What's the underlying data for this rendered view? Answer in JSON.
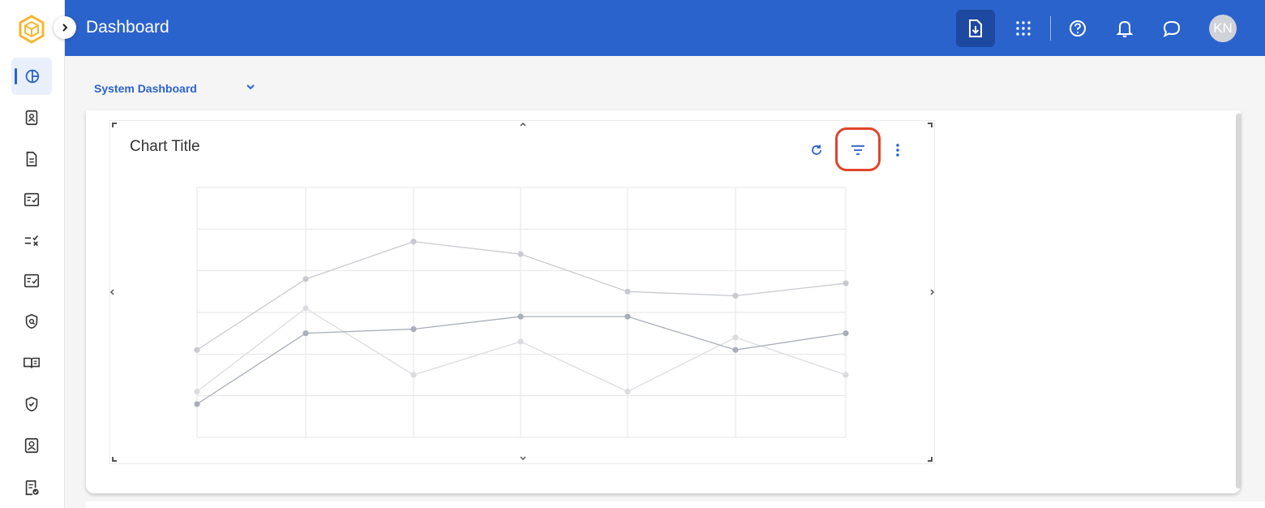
{
  "header": {
    "title": "Dashboard",
    "avatar_initials": "KN"
  },
  "dashboard_selector": {
    "value": "System Dashboard"
  },
  "widget": {
    "title": "Chart Title"
  },
  "colors": {
    "brand": "#2b63cc",
    "highlight": "#e0452a"
  },
  "sidebar": {
    "items": [
      {
        "icon": "dashboard-pie-icon",
        "active": true
      },
      {
        "icon": "contact-card-icon"
      },
      {
        "icon": "document-icon"
      },
      {
        "icon": "checklist-icon"
      },
      {
        "icon": "list-check-x-icon"
      },
      {
        "icon": "task-list-icon"
      },
      {
        "icon": "shield-search-icon"
      },
      {
        "icon": "book-icon"
      },
      {
        "icon": "shield-check-icon"
      },
      {
        "icon": "user-card-icon"
      },
      {
        "icon": "document-check-icon"
      }
    ]
  },
  "chart_data": {
    "type": "line",
    "x": [
      0,
      1,
      2,
      3,
      4,
      5,
      6
    ],
    "ylim": [
      0,
      6
    ],
    "grid": true,
    "series": [
      {
        "values": [
          2.1,
          3.8,
          4.7,
          4.4,
          3.5,
          3.4,
          3.7
        ],
        "color": "#c8cacf"
      },
      {
        "values": [
          1.1,
          3.1,
          1.5,
          2.3,
          1.1,
          2.4,
          1.5
        ],
        "color": "#dadcdf"
      },
      {
        "values": [
          0.8,
          2.5,
          2.6,
          2.9,
          2.9,
          2.1,
          2.5
        ],
        "color": "#a9aeb8"
      }
    ]
  }
}
